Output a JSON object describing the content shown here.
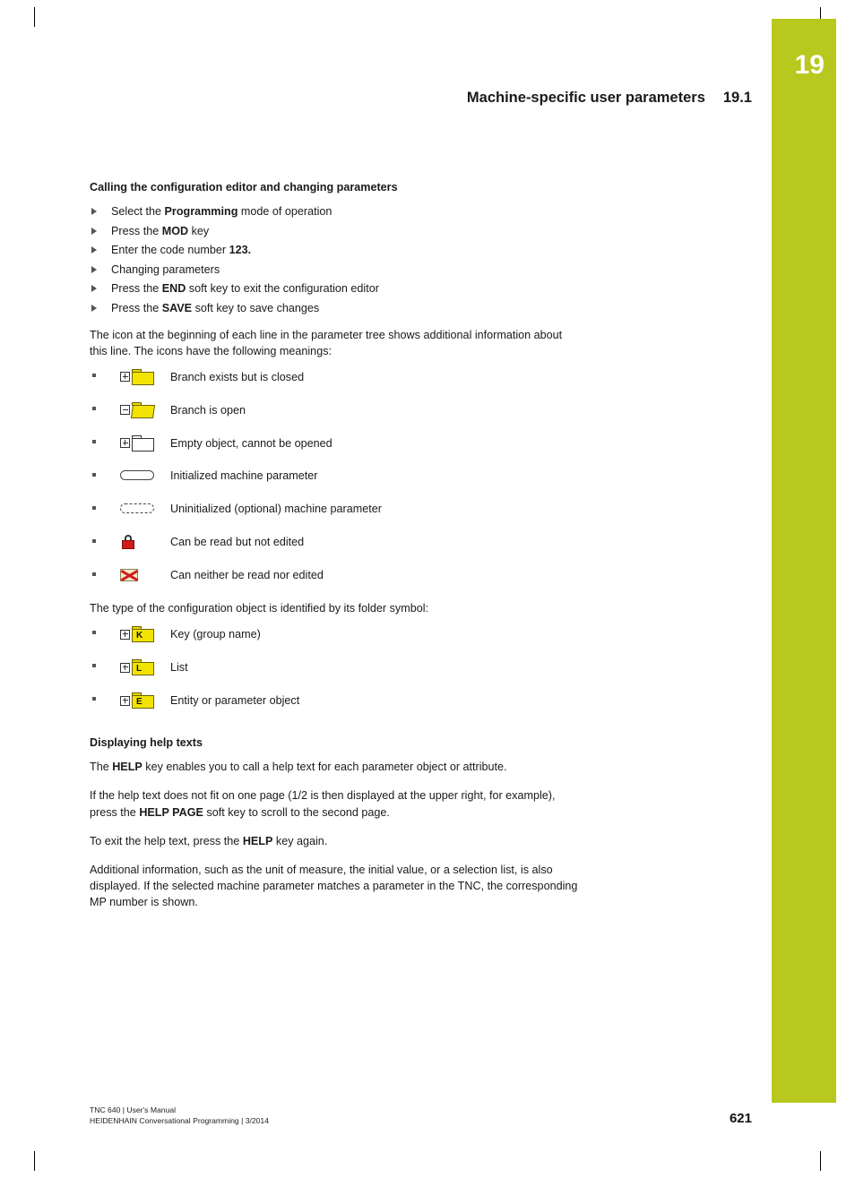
{
  "chapter": {
    "number": "19",
    "header_title": "Machine-specific user parameters",
    "header_section": "19.1"
  },
  "sections": {
    "calling_heading": "Calling the configuration editor and changing parameters",
    "steps": [
      {
        "pre": "Select the ",
        "bold": "Programming",
        "post": " mode of operation"
      },
      {
        "pre": "Press the ",
        "bold": "MOD",
        "post": " key"
      },
      {
        "pre": "Enter the code number ",
        "bold": "123.",
        "post": ""
      },
      {
        "pre": "Changing parameters",
        "bold": "",
        "post": ""
      },
      {
        "pre": "Press the ",
        "bold": "END",
        "post": " soft key to exit the configuration editor"
      },
      {
        "pre": "Press the ",
        "bold": "SAVE",
        "post": " soft key to save changes"
      }
    ],
    "icon_intro": "The icon at the beginning of each line in the parameter tree shows additional information about this line. The icons have the following meanings:",
    "icon_list": [
      {
        "icon": "folder-closed-plus-icon",
        "label": "Branch exists but is closed"
      },
      {
        "icon": "folder-open-minus-icon",
        "label": "Branch is open"
      },
      {
        "icon": "empty-object-icon",
        "label": "Empty object, cannot be opened"
      },
      {
        "icon": "initialized-parameter-icon",
        "label": "Initialized machine parameter"
      },
      {
        "icon": "uninitialized-parameter-icon",
        "label": "Uninitialized (optional) machine parameter"
      },
      {
        "icon": "read-only-lock-icon",
        "label": "Can be read but not edited"
      },
      {
        "icon": "no-read-no-edit-icon",
        "label": "Can neither be read nor edited"
      }
    ],
    "folder_intro": "The type of the configuration object is identified by its folder symbol:",
    "folder_list": [
      {
        "icon": "folder-key-icon",
        "glyph": "K",
        "label": "Key (group name)"
      },
      {
        "icon": "folder-list-icon",
        "glyph": "L",
        "label": "List"
      },
      {
        "icon": "folder-entity-icon",
        "glyph": "E",
        "label": "Entity or parameter object"
      }
    ],
    "help_heading": "Displaying help texts",
    "help_paragraphs": [
      {
        "pre": "The ",
        "bold": "HELP",
        "post": " key enables you to call a help text for each parameter object or attribute."
      },
      {
        "pre": "If the help text does not fit on one page (1/2 is then displayed at the upper right, for example), press the ",
        "bold": "HELP PAGE",
        "post": " soft key to scroll to the second page."
      },
      {
        "pre": "To exit the help text, press the ",
        "bold": "HELP",
        "post": " key again."
      },
      {
        "pre": "Additional information, such as the unit of measure, the initial value, or a selection list, is also displayed. If the selected machine parameter matches a parameter in the TNC, the corresponding MP number is shown.",
        "bold": "",
        "post": ""
      }
    ]
  },
  "footer": {
    "line1": "TNC 640 | User's Manual",
    "line2": "HEIDENHAIN Conversational Programming | 3/2014",
    "page_number": "621"
  },
  "colors": {
    "tab_green": "#b8c81e",
    "folder_yellow": "#f2e400",
    "lock_red": "#d11a1a"
  }
}
